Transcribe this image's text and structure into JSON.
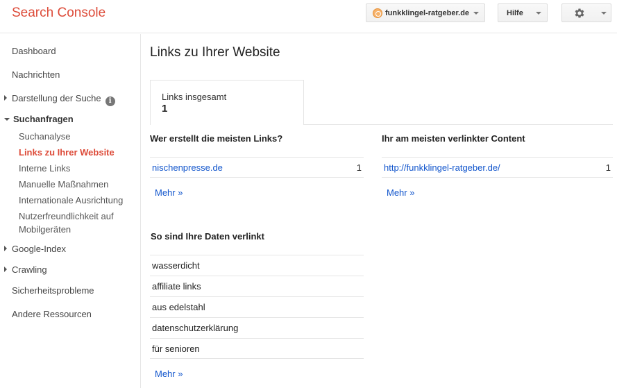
{
  "header": {
    "app_title": "Search Console",
    "site": "funkklingel-ratgeber.de",
    "help": "Hilfe",
    "settings_icon": "gear-icon"
  },
  "sidebar": {
    "items": [
      {
        "label": "Dashboard"
      },
      {
        "label": "Nachrichten"
      },
      {
        "label": "Darstellung der Suche"
      },
      {
        "label": "Suchanfragen"
      },
      {
        "label": "Google-Index"
      },
      {
        "label": "Crawling"
      },
      {
        "label": "Sicherheitsprobleme"
      },
      {
        "label": "Andere Ressourcen"
      }
    ],
    "sub_items": [
      {
        "label": "Suchanalyse"
      },
      {
        "label": "Links zu Ihrer Website"
      },
      {
        "label": "Interne Links"
      },
      {
        "label": "Manuelle Maßnahmen"
      },
      {
        "label": "Internationale Ausrichtung"
      },
      {
        "label": "Nutzerfreundlichkeit auf"
      },
      {
        "label": "Mobilgeräten"
      }
    ]
  },
  "main": {
    "title": "Links zu Ihrer Website",
    "total_label": "Links insgesamt",
    "total_value": "1",
    "who_links": {
      "heading": "Wer erstellt die meisten Links?",
      "rows": [
        {
          "domain": "nischenpresse.de",
          "count": "1"
        }
      ],
      "more": "Mehr »"
    },
    "top_content": {
      "heading": "Ihr am meisten verlinkter Content",
      "rows": [
        {
          "url": "http://funkklingel-ratgeber.de/",
          "count": "1"
        }
      ],
      "more": "Mehr »"
    },
    "anchors": {
      "heading": "So sind Ihre Daten verlinkt",
      "rows": [
        "wasserdicht",
        "affiliate links",
        "aus edelstahl",
        "datenschutzerklärung",
        "für senioren"
      ],
      "more": "Mehr »"
    }
  },
  "colors": {
    "brand": "#dd4b39",
    "link": "#1155cc",
    "border": "#e5e5e5"
  }
}
